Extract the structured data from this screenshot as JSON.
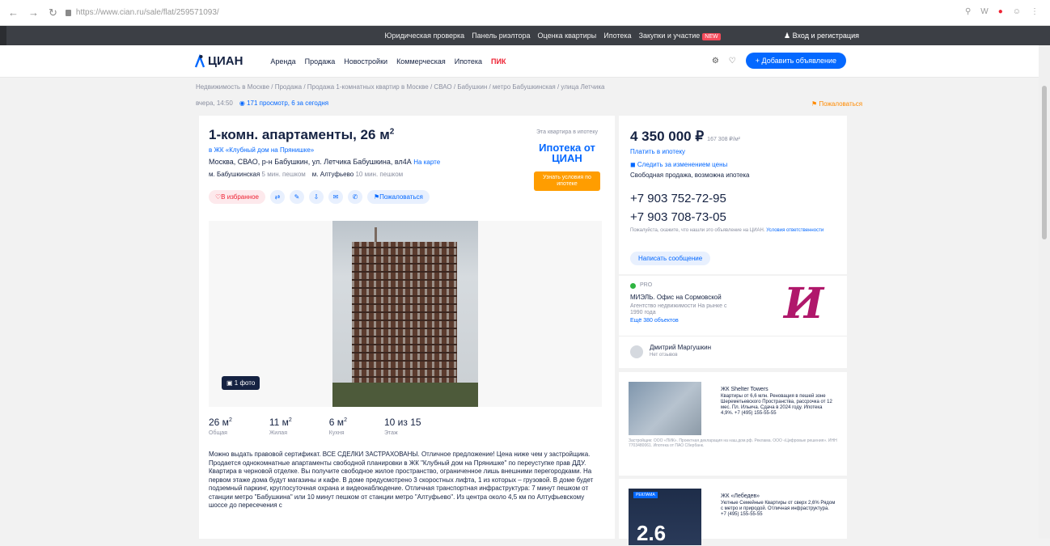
{
  "browser": {
    "url": "https://www.cian.ru/sale/flat/259571093/"
  },
  "topbar": {
    "links": [
      "Юридическая проверка",
      "Панель риэлтора",
      "Оценка квартиры",
      "Ипотека",
      "Закупки и участие"
    ],
    "badge": "NEW",
    "login": "Вход и регистрация"
  },
  "header": {
    "logo": "ЦИАН",
    "menu": [
      "Аренда",
      "Продажа",
      "Новостройки",
      "Коммерческая",
      "Ипотека"
    ],
    "pik": "ПИК",
    "add_button": "+ Добавить объявление"
  },
  "breadcrumbs": "Недвижимость в Москве / Продажа / Продажа 1-комнатных квартир в Москве / СВАО / Бабушкин / метро Бабушкинская / улица Летчика",
  "subcrumb": {
    "date": "вчера, 14:50",
    "views": "171 просмотр, 6 за сегодня",
    "report": "Пожаловаться"
  },
  "listing": {
    "title": "1-комн. апартаменты, 26 м",
    "title_sup": "2",
    "jk": "в ЖК «Клубный дом на Прянишке»",
    "address": "Москва, СВАО, р-н Бабушкин, ул. Летчика Бабушкина, вл4А",
    "address_link": "На карте",
    "metro": [
      {
        "name": "м. Бабушкинская",
        "time": "5 мин. пешком"
      },
      {
        "name": "м. Алтуфьево",
        "time": "10 мин. пешком"
      }
    ],
    "fav_label": "В избранное",
    "share_label": "Пожаловаться",
    "photo_count": "1 фото",
    "mortgage": {
      "label": "Эта квартира в ипотеку",
      "title": "Ипотека от ЦИАН",
      "button": "Узнать условия по ипотеке"
    },
    "specs": [
      {
        "value": "26 м",
        "sup": "2",
        "label": "Общая"
      },
      {
        "value": "11 м",
        "sup": "2",
        "label": "Жилая"
      },
      {
        "value": "6 м",
        "sup": "2",
        "label": "Кухня"
      },
      {
        "value": "10 из 15",
        "sup": "",
        "label": "Этаж"
      }
    ],
    "description": "Можно выдать правовой сертификат. ВСЕ СДЕЛКИ ЗАСТРАХОВАНЫ. Отличное предложение! Цена ниже чем у застройщика. Продается однокомнатные апартаменты свободной планировки в ЖК \"Клубный дом на Прянишке\" по переуступке прав ДДУ. Квартира в черновой отделке. Вы получите свободное жилое пространство, ограниченное лишь внешними перегородками. На первом этаже дома будут магазины и кафе. В доме предусмотрено 3 скоростных лифта, 1 из которых – грузовой. В доме будет подземный паркинг, круглосуточная охрана и видеонаблюдение. Отличная транспортная инфраструктура: 7 минут пешком от станции метро \"Бабушкина\" или 10 минут пешком от станции метро \"Алтуфьево\". Из центра около 4,5 км по Алтуфьевскому шоссе до пересечения с"
  },
  "sidebar": {
    "price": "4 350 000 ₽",
    "price_per_meter": "167 308 ₽/м²",
    "calc": "Платить в ипотеку",
    "watch": "Следить за изменением цены",
    "sale_type": "Свободная продажа, возможна ипотека",
    "phones": [
      "+7 903 752-72-95",
      "+7 903 708-73-05"
    ],
    "note_text": "Пожалуйста, скажите, что нашли это объявление на ЦИАН.",
    "note_link": "Условия ответственности",
    "msg_button": "Написать сообщение"
  },
  "agency": {
    "pro": "PRO",
    "name": "МИЭЛЬ. Офис на Сормовской",
    "desc": "Агентство недвижимости На рынке с 1990 года",
    "more": "Ещё 380 объектов",
    "person": "Дмитрий Маргушкин",
    "role": "Нет отзывов"
  },
  "ads": [
    {
      "title": "ЖК Shelter Towers",
      "text": "Квартиры от 6,6 млн. Реновация в пешей зоне Шереметьевского Пространства, рассрочка от 12 мес. Пл. Ильича. Сдача в 2024 году. Ипотека 4,9%. +7 (495) 155-55-55",
      "fine": "Застройщик: ООО «ПИК». Проектная декларация на наш.дом.рф. Реклама. ООО «Цифровые решения». ИНН 7703480061. Ипотека от ПАО Сбербанк."
    },
    {
      "tag": "РЕКЛАМА",
      "big": "2.6",
      "title": "ЖК «Лебедев»",
      "text": "Уютные Семейные Квартиры от сверх 2,6% Рядом с метро и природой. Отличная инфраструктура. +7 (495) 155-55-55"
    }
  ]
}
